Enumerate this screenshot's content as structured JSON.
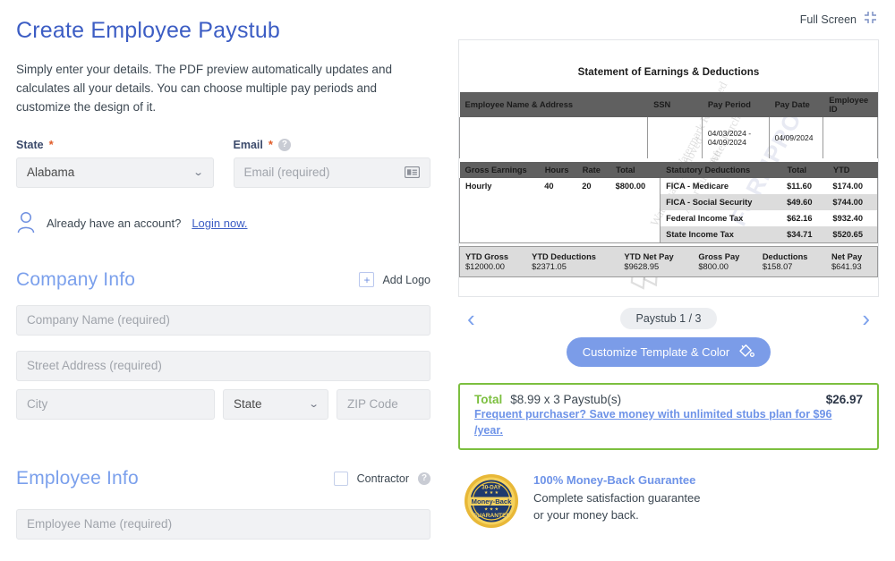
{
  "page": {
    "title": "Create Employee Paystub",
    "intro": "Simply enter your details. The PDF preview automatically updates and calculates all your details. You can choose multiple pay periods and customize the design of it."
  },
  "form": {
    "state": {
      "label": "State",
      "required_mark": "*",
      "value": "Alabama"
    },
    "email": {
      "label": "Email",
      "required_mark": "*",
      "placeholder": "Email (required)",
      "help_icon": "help-circle-icon",
      "field_icon": "contact-card-icon"
    },
    "login": {
      "icon": "user-icon",
      "text": "Already have an account?",
      "link": "Login now."
    },
    "company": {
      "section_title": "Company Info",
      "add_logo_label": "Add Logo",
      "add_logo_icon": "plus-icon",
      "company_name_placeholder": "Company Name (required)",
      "street_placeholder": "Street Address (required)",
      "city_placeholder": "City",
      "state_placeholder": "State",
      "zip_placeholder": "ZIP Code"
    },
    "employee": {
      "section_title": "Employee Info",
      "contractor_label": "Contractor",
      "contractor_checked": false,
      "help_icon": "help-circle-icon",
      "employee_name_placeholder": "Employee Name (required)"
    }
  },
  "preview": {
    "fullscreen_label": "Full Screen",
    "fullscreen_icon": "collapse-icon",
    "stub_heading": "Statement of Earnings & Deductions",
    "watermark": [
      "Watermark Removed",
      "After Purchase",
      "Watermark Removed",
      "After Purchase"
    ],
    "watermark_big": "FORMPROS",
    "employee_header": [
      "Employee Name & Address",
      "SSN",
      "Pay Period",
      "Pay Date",
      "Employee ID"
    ],
    "employee_values": {
      "name_address": "",
      "ssn": "",
      "pay_period": "04/03/2024 - 04/09/2024",
      "pay_date": "04/09/2024",
      "employee_id": ""
    },
    "earnings_header": [
      "Gross Earnings",
      "Hours",
      "Rate",
      "Total"
    ],
    "earnings_rows": [
      {
        "type": "Hourly",
        "hours": "40",
        "rate": "20",
        "total": "$800.00"
      }
    ],
    "deductions_header": [
      "Statutory Deductions",
      "Total",
      "YTD"
    ],
    "deductions_rows": [
      {
        "name": "FICA - Medicare",
        "total": "$11.60",
        "ytd": "$174.00"
      },
      {
        "name": "FICA - Social Security",
        "total": "$49.60",
        "ytd": "$744.00"
      },
      {
        "name": "Federal Income Tax",
        "total": "$62.16",
        "ytd": "$932.40"
      },
      {
        "name": "State Income Tax",
        "total": "$34.71",
        "ytd": "$520.65"
      }
    ],
    "summary_labels": [
      "YTD Gross",
      "YTD Deductions",
      "YTD Net Pay",
      "Gross Pay",
      "Deductions",
      "Net Pay"
    ],
    "summary_values": [
      "$12000.00",
      "$2371.05",
      "$9628.95",
      "$800.00",
      "$158.07",
      "$641.93"
    ],
    "pager": {
      "prev_icon": "chevron-left-icon",
      "next_icon": "chevron-right-icon",
      "label": "Paystub 1 / 3"
    },
    "customize_button": {
      "label": "Customize Template & Color",
      "icon": "paint-bucket-icon"
    }
  },
  "total": {
    "word": "Total",
    "description": "$8.99 x 3 Paystub(s)",
    "amount": "$26.97",
    "promo": "Frequent purchaser? Save money with unlimited stubs plan for $96 /year."
  },
  "guarantee": {
    "badge_icon": "money-back-badge-icon",
    "badge_top": "30-DAY",
    "badge_mid": "Money-Back",
    "badge_bottom": "GUARANTEE",
    "heading": "100% Money-Back Guarantee",
    "line1": "Complete satisfaction guarantee",
    "line2": "or your money back."
  },
  "colors": {
    "title_blue": "#3c5dc4",
    "section_blue": "#7ba0ec",
    "accent_button": "#7b9ce8",
    "green": "#7cbf3f",
    "required_orange": "#e05b28",
    "table_header_gray": "#606060"
  }
}
